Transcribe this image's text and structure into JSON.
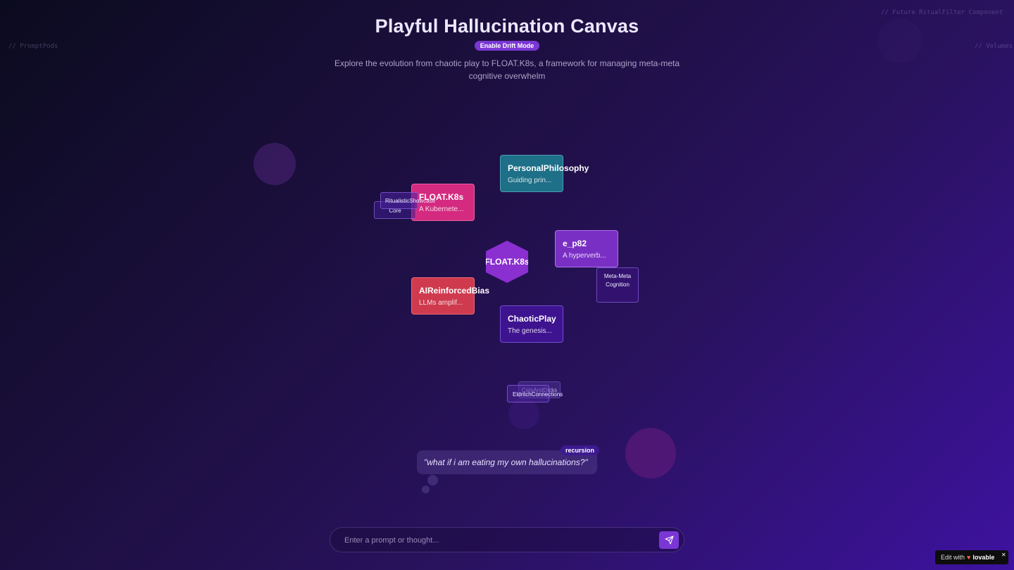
{
  "corner_notes": {
    "top_right": "// Future RitualFilter Component",
    "left": "// PromptPods",
    "right": "// Volumes"
  },
  "header": {
    "title": "Playful Hallucination Canvas",
    "drift_button": "Enable Drift Mode",
    "subtitle": "Explore the evolution from chaotic play to FLOAT.K8s, a framework for managing meta-meta cognitive overwhelm"
  },
  "nodes": {
    "personal_philosophy": {
      "title": "PersonalPhilosophy",
      "desc": "Guiding prin..."
    },
    "float_k8s": {
      "title": "FLOAT.K8s",
      "desc": "A Kubernete..."
    },
    "e_p82": {
      "title": "e_p82",
      "desc": "A hyperverb..."
    },
    "ai_reinforced_bias": {
      "title": "AIReinforcedBias",
      "desc": "LLMs amplif..."
    },
    "chaotic_play": {
      "title": "ChaoticPlay",
      "desc": "The genesis..."
    }
  },
  "center_hex": "FLOAT.K8s",
  "tags": {
    "ritualistic_showcase": "RitualisticShowcase",
    "core": "Core",
    "meta_meta_cognition": "Meta-Meta Cognition",
    "cats_and_dicks": "CatsAndDicks",
    "eldritch_connections": "EldritchConnections"
  },
  "thought_bubble": {
    "text": "\"what if i am eating my own hallucinations?\"",
    "badge": "recursion"
  },
  "prompt": {
    "placeholder": "Enter a prompt or thought..."
  },
  "edit_badge": {
    "prefix": "Edit with",
    "brand": "lovable"
  },
  "icons": {
    "send": "send-icon",
    "heart": "lovable-heart-icon",
    "close": "close-icon"
  },
  "colors": {
    "personal_philosophy": "#1e6f88",
    "float_k8s": "#d42a7f",
    "e_p82": "#7a2fc4",
    "ai_reinforced_bias": "#cf3a4e",
    "chaotic_play": "#3e138f",
    "hex": "#8a2fd0",
    "accent": "#7a37d4"
  }
}
